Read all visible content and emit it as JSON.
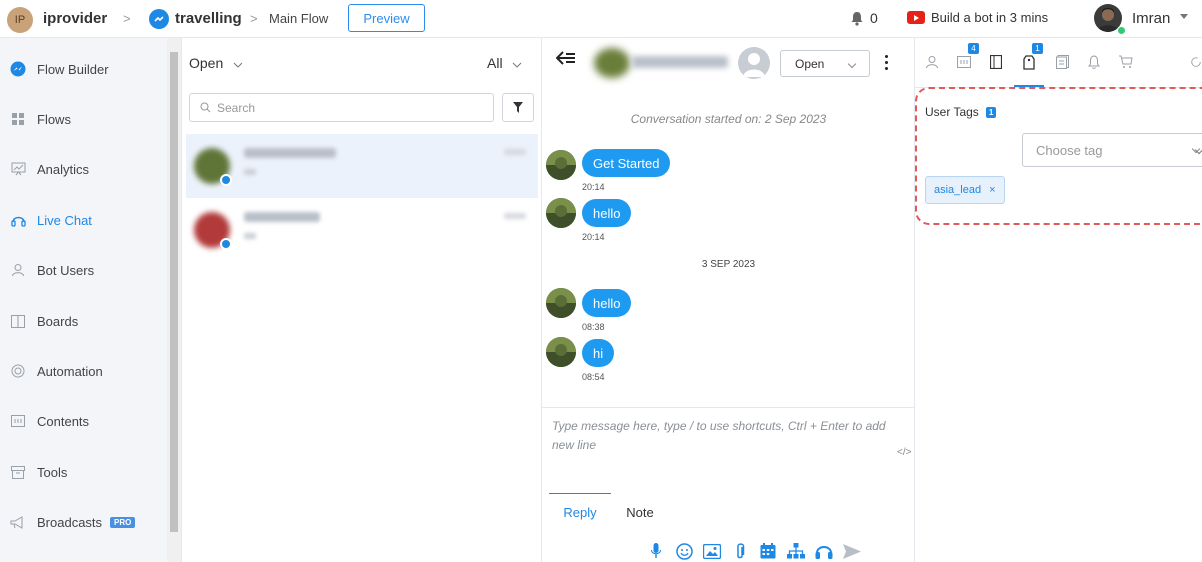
{
  "topbar": {
    "workspace_initials": "IP",
    "workspace_name": "iprovider",
    "separator": ">",
    "bot_name": "travelling",
    "flow_name": "Main Flow",
    "preview_label": "Preview",
    "notifications_count": "0",
    "promo_text": "Build a bot in 3 mins",
    "user_name": "Imran"
  },
  "sidebar": {
    "items": [
      {
        "label": "Flow Builder",
        "icon": "messenger-icon"
      },
      {
        "label": "Flows",
        "icon": "grid-icon"
      },
      {
        "label": "Analytics",
        "icon": "analytics-icon"
      },
      {
        "label": "Live Chat",
        "icon": "headset-icon"
      },
      {
        "label": "Bot Users",
        "icon": "user-icon"
      },
      {
        "label": "Boards",
        "icon": "board-icon"
      },
      {
        "label": "Automation",
        "icon": "automation-icon"
      },
      {
        "label": "Contents",
        "icon": "contents-icon"
      },
      {
        "label": "Tools",
        "icon": "tools-icon"
      },
      {
        "label": "Broadcasts",
        "icon": "megaphone-icon",
        "badge": "PRO"
      }
    ],
    "active": "Live Chat"
  },
  "conversations": {
    "status_filter": "Open",
    "scope_filter": "All",
    "search_placeholder": "Search"
  },
  "chat": {
    "status": "Open",
    "conversation_start": "Conversation started on: 2 Sep 2023",
    "day_separator": "3 SEP 2023",
    "messages": [
      {
        "text": "Get Started",
        "time": "20:14"
      },
      {
        "text": "hello",
        "time": "20:14"
      },
      {
        "text": "hello",
        "time": "08:38"
      },
      {
        "text": "hi",
        "time": "08:54"
      }
    ],
    "composer_placeholder": "Type message here, type / to use shortcuts, Ctrl + Enter to add new line",
    "code_toggle": "</>",
    "tabs": {
      "reply": "Reply",
      "note": "Note"
    }
  },
  "right_panel": {
    "tab_counts": {
      "notes": "4",
      "tags": "1"
    },
    "user_tags_title": "User Tags",
    "user_tags_count": "1",
    "choose_tag_placeholder": "Choose tag",
    "tags": [
      "asia_lead"
    ],
    "tag_remove": "×"
  },
  "colors": {
    "accent": "#1e88e5",
    "bubble": "#1e9bf0",
    "highlight_dash": "#e05a5a",
    "online": "#2ecc71"
  }
}
